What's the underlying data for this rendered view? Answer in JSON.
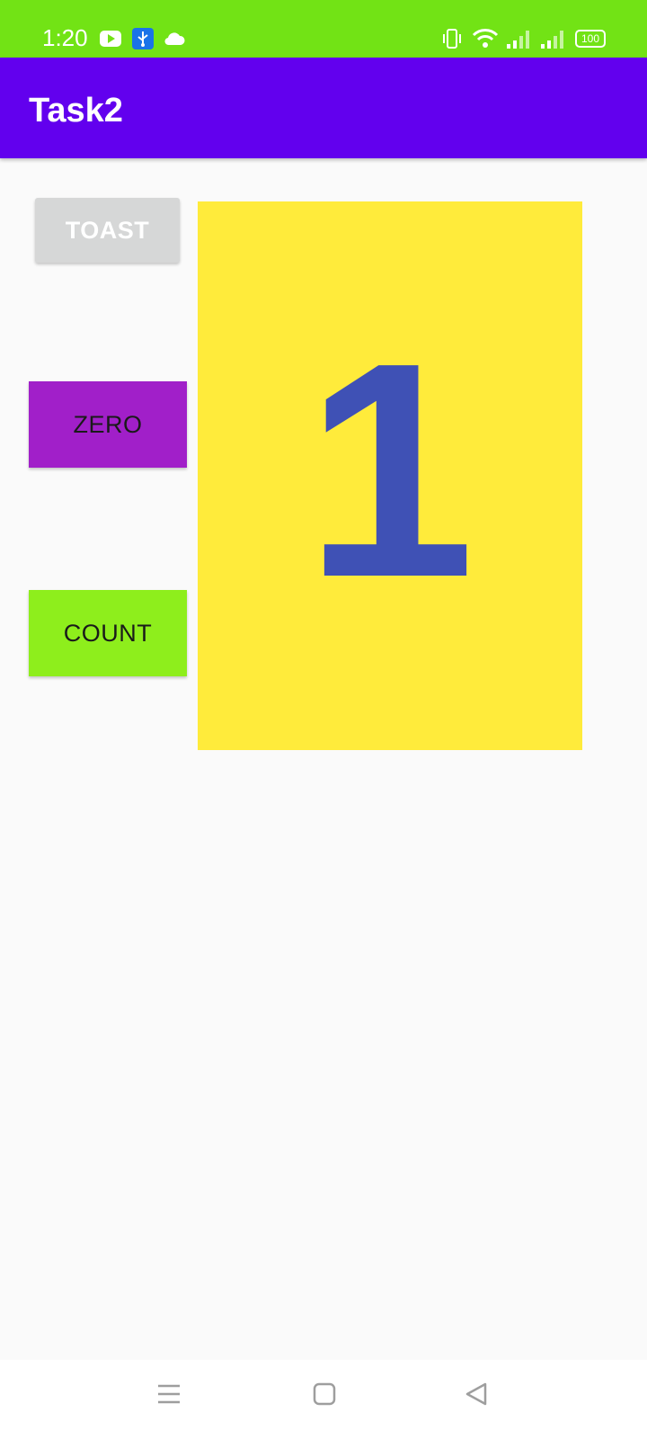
{
  "status_bar": {
    "time": "1:20",
    "battery": "100",
    "icons": [
      "youtube-icon",
      "usb-icon",
      "cloud-icon",
      "vibrate-icon",
      "wifi-icon",
      "signal-icon",
      "signal-icon",
      "battery-icon"
    ],
    "color": "#72e315"
  },
  "app_bar": {
    "title": "Task2",
    "color": "#6200ee"
  },
  "buttons": {
    "toast_label": "TOAST",
    "zero_label": "ZERO",
    "count_label": "COUNT",
    "toast_color": "#d6d7d7",
    "zero_color": "#a11fc9",
    "count_color": "#8eee1c"
  },
  "counter": {
    "value": "1",
    "background": "#ffeb3b",
    "text_color": "#3f51b5"
  },
  "nav_bar": {
    "icons": [
      "menu-icon",
      "home-icon",
      "back-icon"
    ]
  }
}
